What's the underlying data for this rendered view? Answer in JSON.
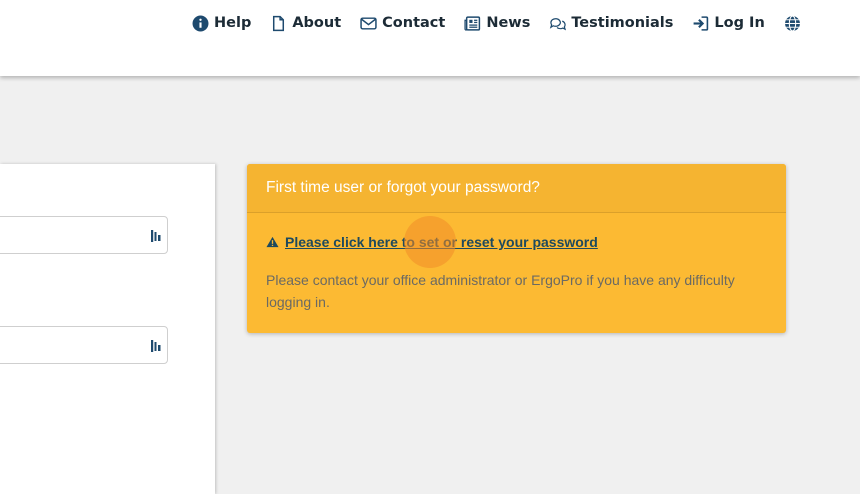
{
  "nav": {
    "help": "Help",
    "about": "About",
    "contact": "Contact",
    "news": "News",
    "testimonials": "Testimonials",
    "login": "Log In",
    "language_icon": "globe-icon"
  },
  "colors": {
    "nav_text": "#1c2b36",
    "nav_icon": "#1e4a6e",
    "notice_bg": "#fcba33",
    "notice_header_bg": "#f5b431",
    "link": "#1e4a5e"
  },
  "notice": {
    "title": "First time user or forgot your password?",
    "link_text": "Please click here to set or reset your password",
    "help_text": "Please contact your office administrator or ErgoPro if you have any difficulty logging in."
  },
  "form": {
    "field1_value": "",
    "field2_value": ""
  }
}
